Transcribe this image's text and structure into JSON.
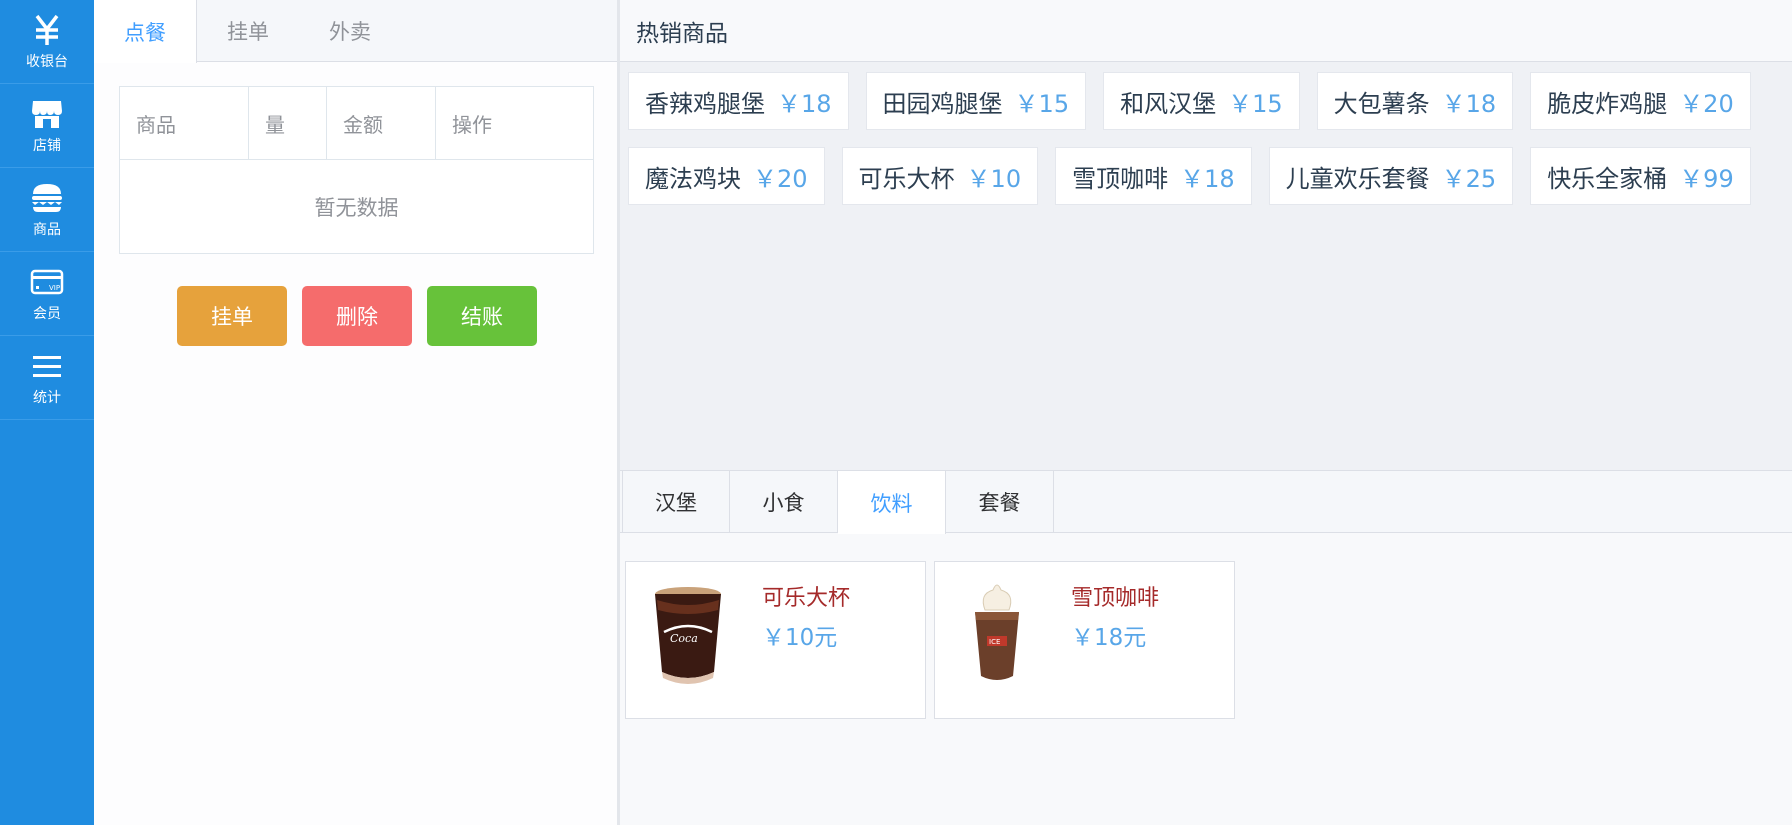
{
  "sidebar": {
    "items": [
      {
        "label": "收银台",
        "icon": "yen-icon"
      },
      {
        "label": "店铺",
        "icon": "shop-icon"
      },
      {
        "label": "商品",
        "icon": "burger-icon"
      },
      {
        "label": "会员",
        "icon": "vip-card-icon"
      },
      {
        "label": "统计",
        "icon": "menu-lines-icon"
      }
    ]
  },
  "order": {
    "tabs": [
      "点餐",
      "挂单",
      "外卖"
    ],
    "columns": [
      "商品",
      "量",
      "金额",
      "操作"
    ],
    "empty_text": "暂无数据",
    "buttons": {
      "hold": "挂单",
      "delete": "删除",
      "checkout": "结账"
    }
  },
  "hot": {
    "title": "热销商品",
    "items": [
      {
        "name": "香辣鸡腿堡",
        "price": "￥18"
      },
      {
        "name": "田园鸡腿堡",
        "price": "￥15"
      },
      {
        "name": "和风汉堡",
        "price": "￥15"
      },
      {
        "name": "大包薯条",
        "price": "￥18"
      },
      {
        "name": "脆皮炸鸡腿",
        "price": "￥20"
      },
      {
        "name": "魔法鸡块",
        "price": "￥20"
      },
      {
        "name": "可乐大杯",
        "price": "￥10"
      },
      {
        "name": "雪顶咖啡",
        "price": "￥18"
      },
      {
        "name": "儿童欢乐套餐",
        "price": "￥25"
      },
      {
        "name": "快乐全家桶",
        "price": "￥99"
      }
    ]
  },
  "categories": {
    "tabs": [
      "汉堡",
      "小食",
      "饮料",
      "套餐"
    ],
    "active": "饮料"
  },
  "goods": [
    {
      "name": "可乐大杯",
      "price": "￥10元"
    },
    {
      "name": "雪顶咖啡",
      "price": "￥18元"
    }
  ],
  "colors": {
    "sidebar": "#1f8ce0",
    "accent": "#409eff",
    "price": "#58a6e8",
    "warn": "#e6a23c",
    "danger": "#f56c6c",
    "success": "#67c23a"
  }
}
